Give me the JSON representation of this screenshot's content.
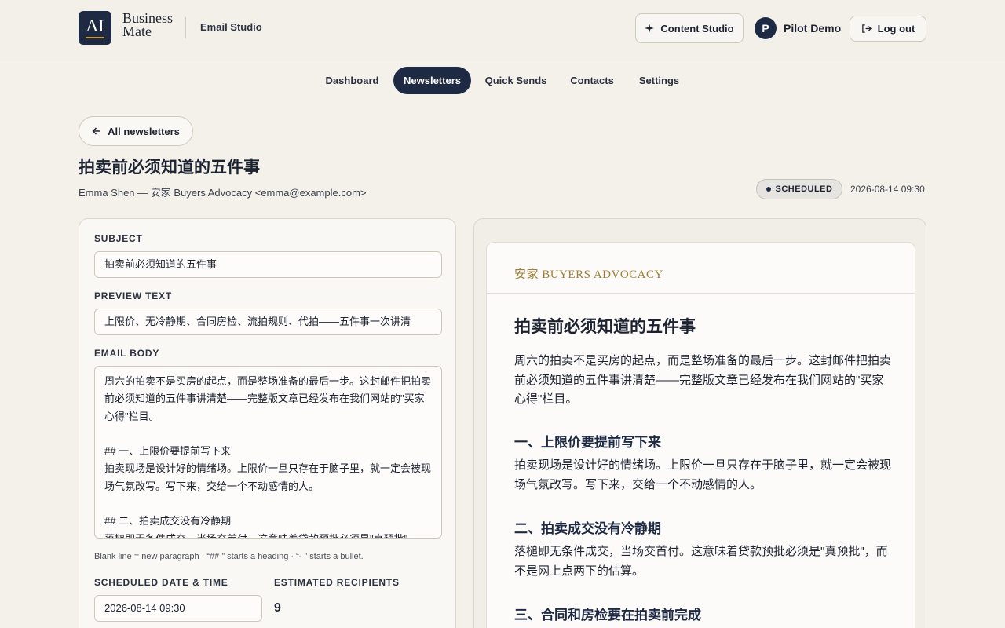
{
  "header": {
    "logo_text": "AI",
    "brand_line1": "Business",
    "brand_line2": "Mate",
    "section": "Email Studio",
    "content_studio_label": "Content Studio",
    "user_initial": "P",
    "user_name": "Pilot Demo",
    "logout_label": "Log out"
  },
  "nav": {
    "items": [
      {
        "label": "Dashboard"
      },
      {
        "label": "Newsletters"
      },
      {
        "label": "Quick Sends"
      },
      {
        "label": "Contacts"
      },
      {
        "label": "Settings"
      }
    ],
    "active": "Newsletters"
  },
  "page": {
    "back_label": "All newsletters",
    "title": "拍卖前必须知道的五件事",
    "sender": "Emma Shen — 安家 Buyers Advocacy <emma@example.com>",
    "status": "SCHEDULED",
    "scheduled_time": "2026-08-14 09:30"
  },
  "editor": {
    "subject_label": "SUBJECT",
    "subject_value": "拍卖前必须知道的五件事",
    "preview_label": "PREVIEW TEXT",
    "preview_value": "上限价、无冷静期、合同房检、流拍规则、代拍——五件事一次讲清",
    "body_label": "EMAIL BODY",
    "body_value": "周六的拍卖不是买房的起点，而是整场准备的最后一步。这封邮件把拍卖前必须知道的五件事讲清楚——完整版文章已经发布在我们网站的\"买家心得\"栏目。\n\n## 一、上限价要提前写下来\n拍卖现场是设计好的情绪场。上限价一旦只存在于脑子里，就一定会被现场气氛改写。写下来，交给一个不动感情的人。\n\n## 二、拍卖成交没有冷静期\n落槌即无条件成交，当场交首付。这意味着贷款预批必须是\"真预批\"，",
    "hint": "Blank line = new paragraph · “## ” starts a heading · “- ” starts a bullet.",
    "schedule_label": "SCHEDULED DATE & TIME",
    "schedule_value": "2026-08-14 09:30",
    "recipients_label": "ESTIMATED RECIPIENTS",
    "recipients_value": "9"
  },
  "preview": {
    "brand": "安家 BUYERS ADVOCACY",
    "title": "拍卖前必须知道的五件事",
    "intro": "周六的拍卖不是买房的起点，而是整场准备的最后一步。这封邮件把拍卖前必须知道的五件事讲清楚——完整版文章已经发布在我们网站的\"买家心得\"栏目。",
    "h1": "一、上限价要提前写下来",
    "p1": "拍卖现场是设计好的情绪场。上限价一旦只存在于脑子里，就一定会被现场气氛改写。写下来，交给一个不动感情的人。",
    "h2": "二、拍卖成交没有冷静期",
    "p2": "落槌即无条件成交，当场交首付。这意味着贷款预批必须是\"真预批\"，而不是网上点两下的估算。",
    "h3": "三、合同和房检要在拍卖前完成"
  },
  "colors": {
    "navy": "#1e2a44",
    "gold": "#a07f33",
    "background": "#f4f1eb"
  },
  "icons": {
    "content_studio": "sparkle-icon",
    "logout": "logout-icon",
    "back": "arrow-left-icon"
  }
}
